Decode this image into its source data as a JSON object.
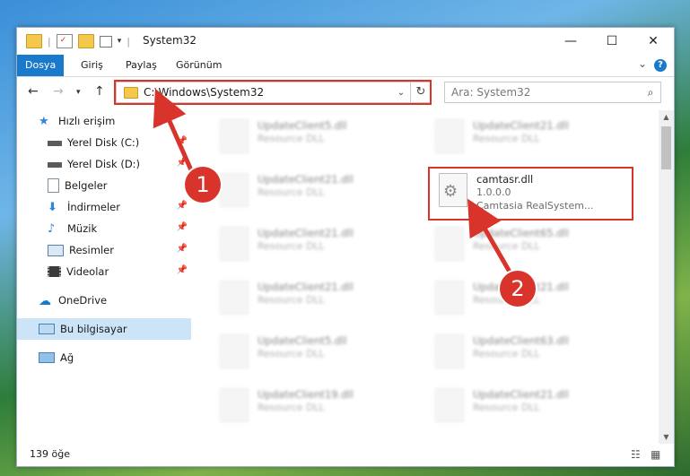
{
  "window": {
    "title": "System32",
    "controls": {
      "minimize": "—",
      "maximize": "☐",
      "close": "✕"
    }
  },
  "ribbon": {
    "tabs": [
      "Dosya",
      "Giriş",
      "Paylaş",
      "Görünüm"
    ],
    "help": "?"
  },
  "address": {
    "path": "C:\\Windows\\System32"
  },
  "search": {
    "placeholder": "Ara: System32"
  },
  "sidebar": {
    "items": [
      {
        "label": "Hızlı erişim",
        "icon": "star-icon"
      },
      {
        "label": "Yerel Disk (C:)",
        "icon": "drive-icon"
      },
      {
        "label": "Yerel Disk (D:)",
        "icon": "drive-icon"
      },
      {
        "label": "Belgeler",
        "icon": "documents-icon"
      },
      {
        "label": "İndirmeler",
        "icon": "download-icon"
      },
      {
        "label": "Müzik",
        "icon": "music-icon"
      },
      {
        "label": "Resimler",
        "icon": "pictures-icon"
      },
      {
        "label": "Videolar",
        "icon": "video-icon"
      },
      {
        "label": "OneDrive",
        "icon": "cloud-icon"
      },
      {
        "label": "Bu bilgisayar",
        "icon": "computer-icon"
      },
      {
        "label": "Ağ",
        "icon": "network-icon"
      }
    ]
  },
  "files": {
    "col1": [
      {
        "name": "UpdateClient5.dll",
        "type": "Resource DLL"
      },
      {
        "name": "UpdateClient21.dll",
        "type": "Resource DLL"
      },
      {
        "name": "UpdateClient21.dll",
        "type": "Resource DLL"
      },
      {
        "name": "UpdateClient21.dll",
        "type": "Resource DLL"
      },
      {
        "name": "UpdateClient5.dll",
        "type": "Resource DLL"
      },
      {
        "name": "UpdateClient19.dll",
        "type": "Resource DLL"
      }
    ],
    "col2": [
      {
        "name": "UpdateClient21.dll",
        "type": "Resource DLL"
      },
      {
        "name": "UpdateClient65.dll",
        "type": "Resource DLL"
      },
      {
        "name": "UpdateClient21.dll",
        "type": "Resource DLL"
      },
      {
        "name": "UpdateClient63.dll",
        "type": "Resource DLL"
      },
      {
        "name": "UpdateClient21.dll",
        "type": "Resource DLL"
      }
    ],
    "highlighted": {
      "name": "camtasr.dll",
      "version": "1.0.0.0",
      "description": "Camtasia RealSystem..."
    }
  },
  "status": {
    "count": "139 öğe"
  },
  "callouts": [
    "1",
    "2"
  ],
  "colors": {
    "accent": "#1979ca",
    "highlight": "#d9342b",
    "selected": "#cce4f7"
  }
}
